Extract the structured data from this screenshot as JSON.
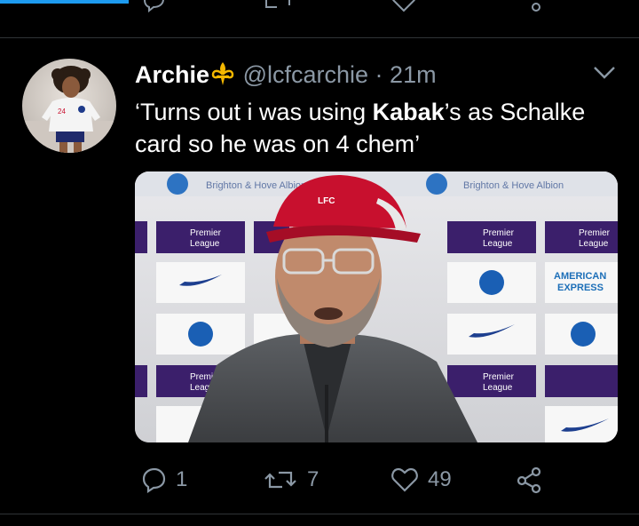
{
  "tweet": {
    "author_name": "Archie",
    "handle": "@lcfcarchie",
    "separator": "·",
    "time": "21m",
    "text_before": "‘Turns out i was using ",
    "text_bold": "Kabak",
    "text_after": "’s as Schalke card so he was on 4 chem’"
  },
  "media": {
    "board_banner": "Brighton & Hove Albion",
    "sponsor_premier_line1": "Premier",
    "sponsor_premier_line2": "League",
    "sponsor_amex_line1": "AMERICAN",
    "sponsor_amex_line2": "EXPRESS",
    "cap_badge": "LFC"
  },
  "actions": {
    "replies": "1",
    "retweets": "7",
    "likes": "49"
  },
  "colors": {
    "background": "#000000",
    "text": "#ffffff",
    "muted": "#8b98a5",
    "accent": "#1d9bf0",
    "divider": "#2f3336"
  },
  "icons": [
    "reply-icon",
    "retweet-icon",
    "like-icon",
    "share-icon",
    "fleur-de-lis-icon",
    "chevron-down-icon"
  ]
}
